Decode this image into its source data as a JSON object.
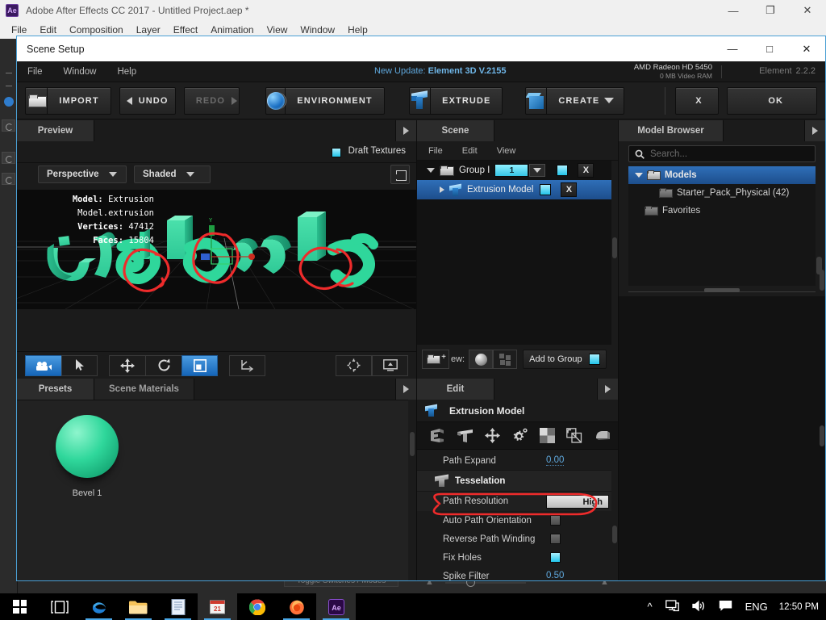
{
  "ae": {
    "title": "Adobe After Effects CC 2017 - Untitled Project.aep *",
    "logo_text": "Ae",
    "menus": [
      "File",
      "Edit",
      "Composition",
      "Layer",
      "Effect",
      "Animation",
      "View",
      "Window",
      "Help"
    ],
    "winbtns": {
      "minimize": "—",
      "maximize": "❐",
      "close": "✕"
    },
    "timeline": {
      "toggle_switches": "Toggle Switches / Modes"
    }
  },
  "dialog": {
    "title": "Scene Setup",
    "winbtns": {
      "minimize": "—",
      "maximize": "□",
      "close": "✕"
    },
    "menus": [
      "File",
      "Window",
      "Help"
    ],
    "update_label": "New Update:",
    "update_version": "Element 3D V.2155",
    "gpu_name": "AMD Radeon HD 5450",
    "gpu_vram": "0 MB Video RAM",
    "product": "Element",
    "product_version": "2.2.2",
    "toolbar": {
      "import": "IMPORT",
      "undo": "UNDO",
      "redo": "REDO",
      "environment": "ENVIRONMENT",
      "extrude": "EXTRUDE",
      "create": "CREATE",
      "cancel": "X",
      "ok": "OK"
    }
  },
  "preview": {
    "tab": "Preview",
    "draft_textures": "Draft Textures",
    "camera_view": "Perspective",
    "shading": "Shaded",
    "stats": [
      {
        "label": "Model:",
        "value": "Extrusion Model.extrusion"
      },
      {
        "label": "Vertices:",
        "value": "47412"
      },
      {
        "label": "Faces:",
        "value": "15804"
      }
    ]
  },
  "presets": {
    "tab_presets": "Presets",
    "tab_scene_materials": "Scene Materials",
    "items": [
      {
        "label": "Bevel 1",
        "color": "#2fd79b"
      }
    ]
  },
  "scene": {
    "tab": "Scene",
    "menus": [
      "File",
      "Edit",
      "View"
    ],
    "rows": [
      {
        "label": "Group I",
        "count": "1",
        "toggle": "on",
        "remove": "X",
        "type": "group"
      },
      {
        "label": "Extrusion Model",
        "toggle": "on",
        "remove": "X",
        "type": "model",
        "selected": true
      }
    ],
    "view_label": "ew:",
    "add_to_group": "Add to Group"
  },
  "edit": {
    "tab": "Edit",
    "object_title": "Extrusion Model",
    "icons": [
      "extrude-icon",
      "tesselation-icon",
      "move-icon",
      "settings-icon",
      "texture-icon",
      "uv-icon",
      "bevel-icon"
    ],
    "properties": [
      {
        "kind": "value",
        "label": "Path Expand",
        "value": "0.00"
      },
      {
        "kind": "section",
        "label": "Tesselation"
      },
      {
        "kind": "segment",
        "label": "Path Resolution",
        "value": "High"
      },
      {
        "kind": "check",
        "label": "Auto Path Orientation",
        "checked": false,
        "annotated": true
      },
      {
        "kind": "check",
        "label": "Reverse Path Winding",
        "checked": false
      },
      {
        "kind": "check",
        "label": "Fix Holes",
        "checked": true
      },
      {
        "kind": "value",
        "label": "Spike Filter",
        "value": "0.50"
      }
    ]
  },
  "model_browser": {
    "tab": "Model Browser",
    "search_placeholder": "Search...",
    "tree": [
      {
        "label": "Models",
        "level": 0,
        "expanded": true,
        "selected": true
      },
      {
        "label": "Starter_Pack_Physical (42)",
        "level": 1,
        "expanded": false,
        "selected": false
      },
      {
        "label": "Favorites",
        "level": 0,
        "expanded": false,
        "selected": false
      }
    ]
  },
  "taskbar": {
    "items": [
      "start-icon",
      "task-view-icon",
      "edge-icon",
      "file-explorer-icon",
      "notepad-icon",
      "calendar-icon",
      "chrome-icon",
      "firefox-icon",
      "after-effects-icon"
    ],
    "language": "ENG",
    "clock": "12:50 PM"
  }
}
